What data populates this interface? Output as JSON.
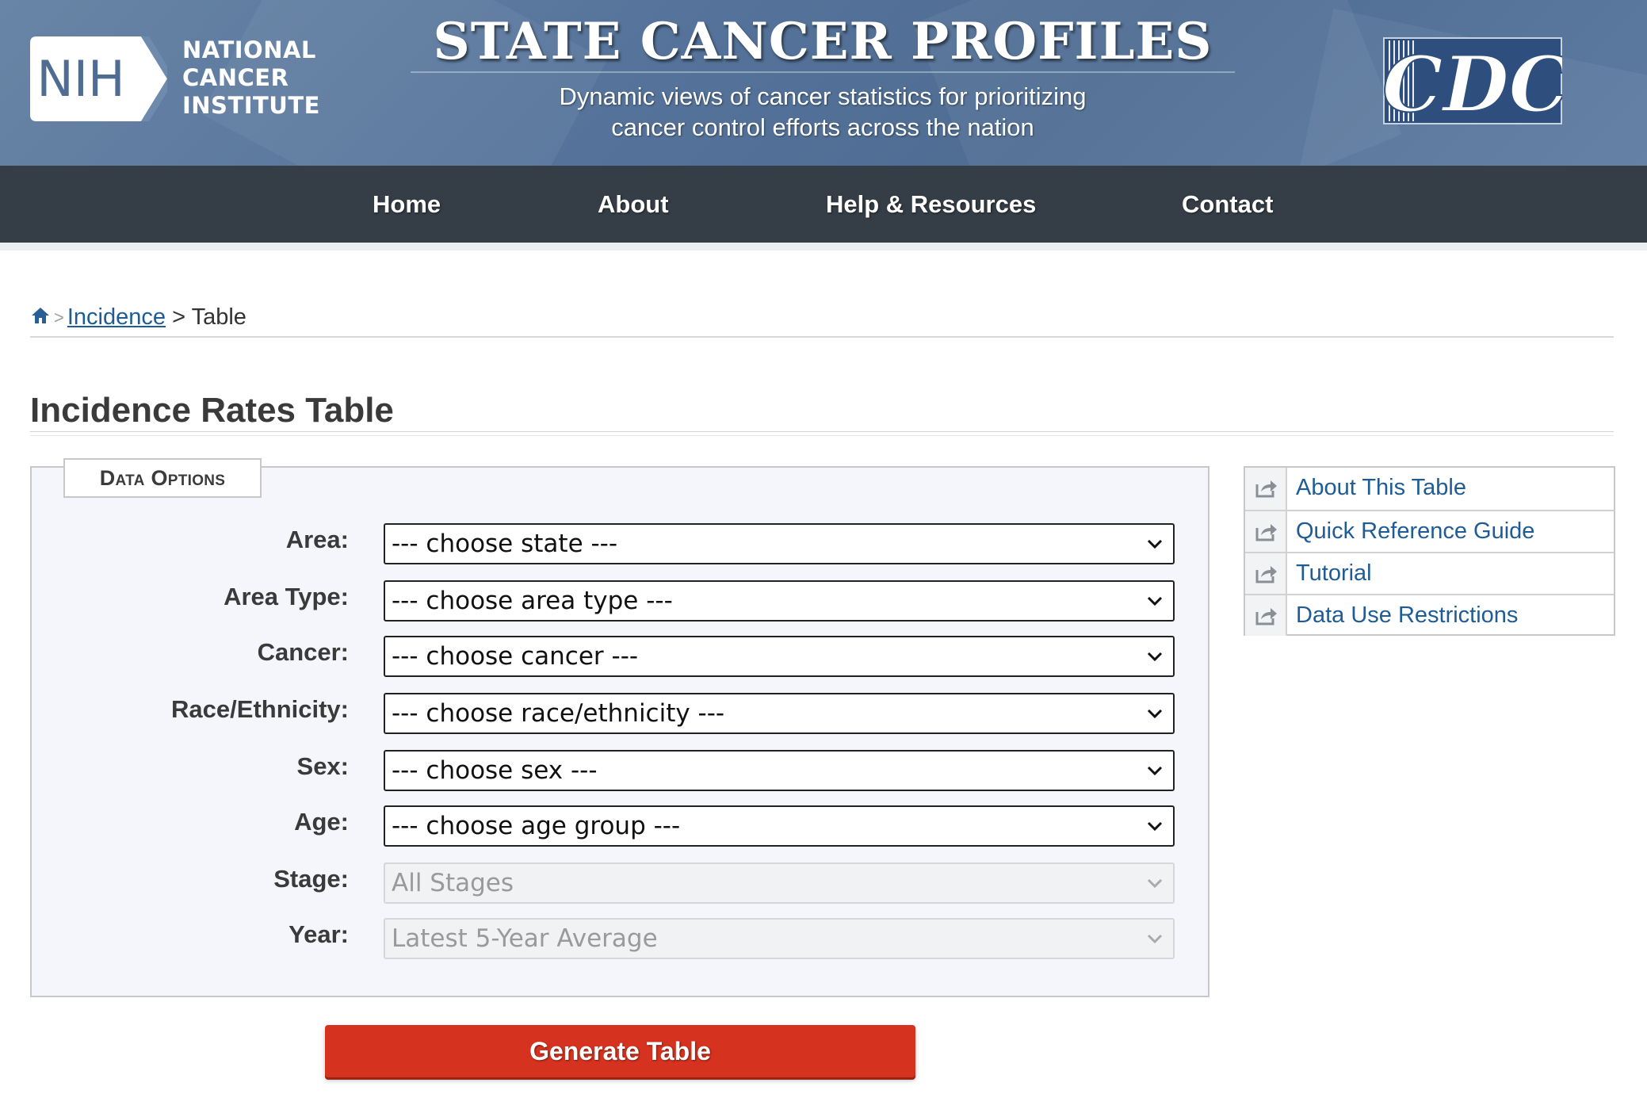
{
  "header": {
    "nih_badge": "NIH",
    "nci_lines": [
      "NATIONAL",
      "CANCER",
      "INSTITUTE"
    ],
    "title": "STATE CANCER PROFILES",
    "subtitle_lines": [
      "Dynamic views of cancer statistics for prioritizing",
      "cancer control efforts across the nation"
    ],
    "cdc_logo": "CDC"
  },
  "nav": {
    "items": [
      "Home",
      "About",
      "Help & Resources",
      "Contact"
    ]
  },
  "breadcrumb": {
    "home_icon": "home-icon",
    "separator_icon": ">",
    "link": "Incidence",
    "separator": ">",
    "current": "Table"
  },
  "page": {
    "title": "Incidence Rates Table"
  },
  "data_options": {
    "legend": "Data Options",
    "fields": [
      {
        "label": "Area:",
        "value": "--- choose state ---",
        "disabled": false
      },
      {
        "label": "Area Type:",
        "value": "--- choose area type ---",
        "disabled": false
      },
      {
        "label": "Cancer:",
        "value": "--- choose cancer ---",
        "disabled": false
      },
      {
        "label": "Race/Ethnicity:",
        "value": "--- choose race/ethnicity ---",
        "disabled": false
      },
      {
        "label": "Sex:",
        "value": "--- choose sex ---",
        "disabled": false
      },
      {
        "label": "Age:",
        "value": "--- choose age group ---",
        "disabled": false
      },
      {
        "label": "Stage:",
        "value": "All Stages",
        "disabled": true
      },
      {
        "label": "Year:",
        "value": "Latest 5-Year Average",
        "disabled": true
      }
    ]
  },
  "actions": {
    "generate": "Generate Table"
  },
  "side_links": {
    "icon": "external-link-icon",
    "items": [
      "About This Table",
      "Quick Reference Guide",
      "Tutorial",
      "Data Use Restrictions"
    ]
  },
  "colors": {
    "banner": "#55739a",
    "navbar": "#353d46",
    "link": "#1f5c96",
    "button": "#d5321f",
    "panel_bg": "#f4f6fb"
  }
}
